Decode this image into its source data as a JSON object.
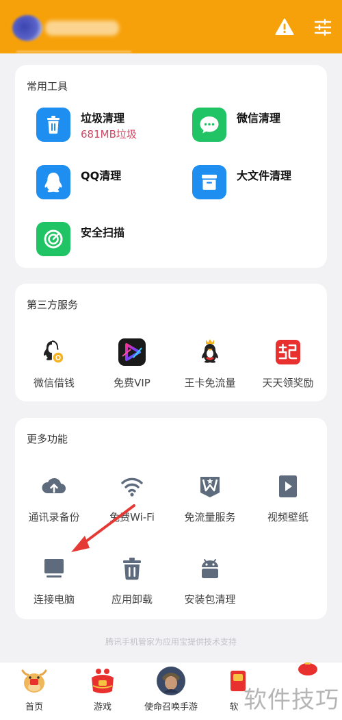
{
  "header": {
    "icons": [
      "warning-icon",
      "settings-sliders-icon"
    ],
    "accent": "#f7a10a"
  },
  "tools": {
    "title": "常用工具",
    "items": [
      {
        "label": "垃圾清理",
        "sub": "681MB垃圾",
        "icon": "trash-icon",
        "color": "#1f8ef1"
      },
      {
        "label": "微信清理",
        "icon": "wechat-icon",
        "color": "#20c464"
      },
      {
        "label": "QQ清理",
        "icon": "qq-penguin-icon",
        "color": "#1f8ef1"
      },
      {
        "label": "大文件清理",
        "icon": "archive-box-icon",
        "color": "#1f8ef1"
      },
      {
        "label": "安全扫描",
        "icon": "scan-gauge-icon",
        "color": "#20c464"
      }
    ]
  },
  "third_party": {
    "title": "第三方服务",
    "items": [
      {
        "label": "微信借钱",
        "icon": "penguin-coin-icon"
      },
      {
        "label": "免费VIP",
        "icon": "video-play-icon"
      },
      {
        "label": "王卡免流量",
        "icon": "crown-penguin-icon"
      },
      {
        "label": "天天领奖励",
        "icon": "qi-badge-icon"
      }
    ]
  },
  "more": {
    "title": "更多功能",
    "items": [
      {
        "label": "通讯录备份",
        "icon": "cloud-upload-icon"
      },
      {
        "label": "免费Wi-Fi",
        "icon": "wifi-icon"
      },
      {
        "label": "免流量服务",
        "icon": "w-star-icon"
      },
      {
        "label": "视频壁纸",
        "icon": "video-file-icon"
      },
      {
        "label": "连接电脑",
        "icon": "monitor-icon"
      },
      {
        "label": "应用卸载",
        "icon": "trash-icon"
      },
      {
        "label": "安装包清理",
        "icon": "android-icon"
      }
    ]
  },
  "footer_note": "腾讯手机管家为应用宝提供技术支持",
  "bottom_nav": [
    {
      "label": "首页",
      "icon": "ox-home-icon"
    },
    {
      "label": "游戏",
      "icon": "gift-bag-icon"
    },
    {
      "label": "使命召唤手游",
      "icon": "game-avatar-icon"
    },
    {
      "label": "软",
      "icon": "red-card-icon"
    },
    {
      "label": "",
      "icon": "red-lantern-icon"
    }
  ],
  "watermark": "软件技巧"
}
